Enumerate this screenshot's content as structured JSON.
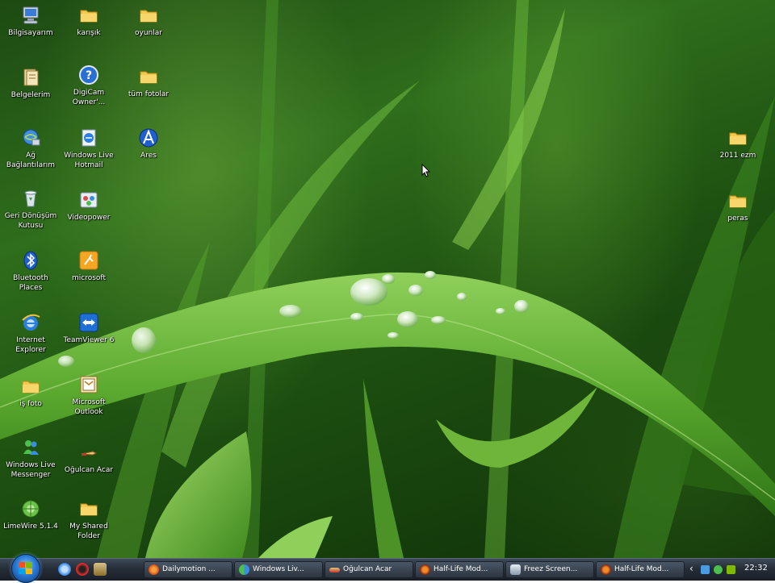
{
  "desktop_icons_left": [
    {
      "label": "Bilgisayarım",
      "icon": "computer-icon"
    },
    {
      "label": "karışık",
      "icon": "folder-icon"
    },
    {
      "label": "oyunlar",
      "icon": "folder-icon"
    },
    {
      "label": "Belgelerim",
      "icon": "documents-icon"
    },
    {
      "label": "DigiCam\nOwner'...",
      "icon": "help-icon"
    },
    {
      "label": "tüm fotolar",
      "icon": "folder-icon"
    },
    {
      "label": "Ağ\nBağlantılarım",
      "icon": "network-icon"
    },
    {
      "label": "Windows Live\nHotmail",
      "icon": "hotmail-icon"
    },
    {
      "label": "Ares",
      "icon": "ares-icon"
    },
    {
      "label": "Geri Dönüşüm\nKutusu",
      "icon": "recycle-bin-icon"
    },
    {
      "label": "Videopower",
      "icon": "videopower-icon"
    },
    {
      "label": "Bluetooth\nPlaces",
      "icon": "bluetooth-icon"
    },
    {
      "label": "microsoft",
      "icon": "microsoft-icon"
    },
    {
      "label": "Internet\nExplorer",
      "icon": "internet-explorer-icon"
    },
    {
      "label": "TeamViewer 6",
      "icon": "teamviewer-icon"
    },
    {
      "label": "iş foto",
      "icon": "folder-icon"
    },
    {
      "label": "Microsoft\nOutlook",
      "icon": "outlook-icon"
    },
    {
      "label": "Windows Live\nMessenger",
      "icon": "messenger-icon"
    },
    {
      "label": "Oğulcan Acar",
      "icon": "shortcut-icon"
    },
    {
      "label": "LimeWire 5.1.4",
      "icon": "limewire-icon"
    },
    {
      "label": "My Shared\nFolder",
      "icon": "folder-icon"
    }
  ],
  "desktop_icons_right": [
    {
      "label": "2011 ezm",
      "icon": "folder-icon"
    },
    {
      "label": "peras",
      "icon": "folder-icon"
    }
  ],
  "taskbar": {
    "tasks": [
      {
        "label": "Dailymotion ...",
        "icon": "firefox-icon"
      },
      {
        "label": "Windows Liv...",
        "icon": "messenger-icon"
      },
      {
        "label": "Oğulcan Acar",
        "icon": "shortcut-icon"
      },
      {
        "label": "Half-Life Mod...",
        "icon": "halflife-icon"
      },
      {
        "label": "Freez Screen...",
        "icon": "video-icon"
      },
      {
        "label": "Half-Life Mod...",
        "icon": "halflife-icon"
      }
    ],
    "tray_arrow": "‹",
    "clock": "22:32"
  },
  "colors": {
    "folder": "#f3c94f",
    "label_text": "#ffffff",
    "taskbar": "#252d37"
  }
}
